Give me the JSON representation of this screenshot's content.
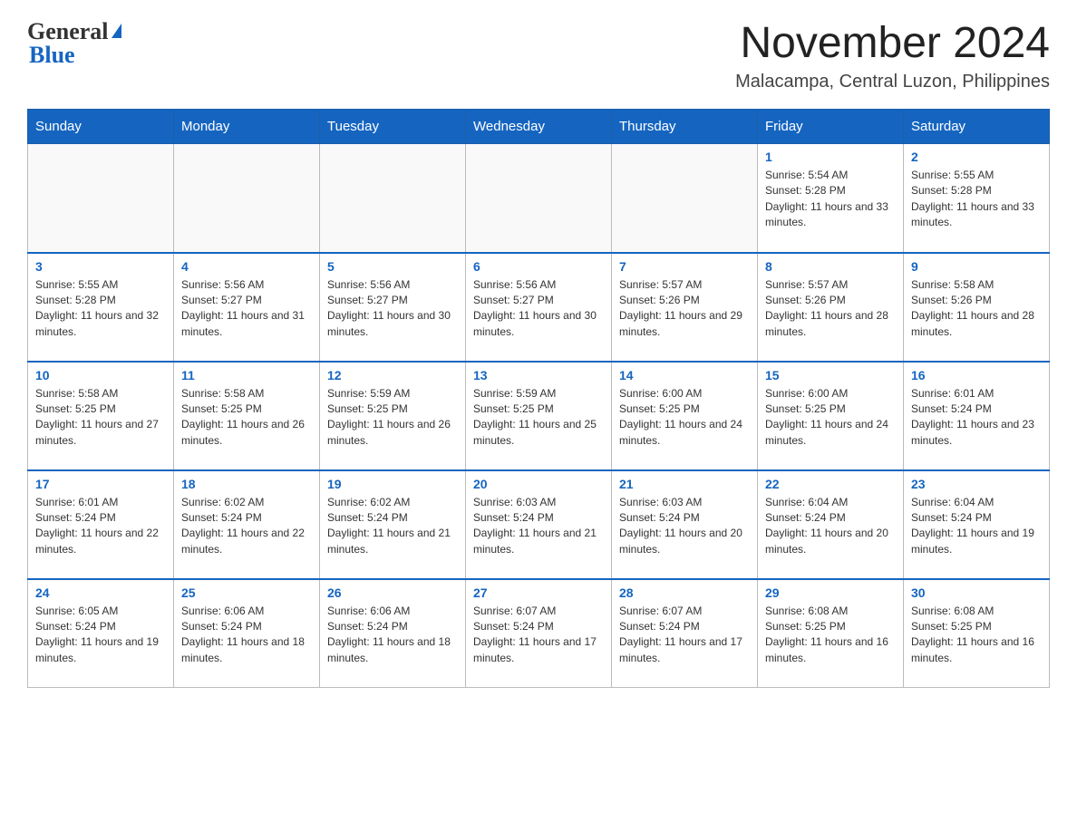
{
  "header": {
    "logo_line1": "General",
    "logo_line2": "Blue",
    "main_title": "November 2024",
    "subtitle": "Malacampa, Central Luzon, Philippines"
  },
  "days_of_week": [
    "Sunday",
    "Monday",
    "Tuesday",
    "Wednesday",
    "Thursday",
    "Friday",
    "Saturday"
  ],
  "weeks": [
    [
      {
        "day": "",
        "info": ""
      },
      {
        "day": "",
        "info": ""
      },
      {
        "day": "",
        "info": ""
      },
      {
        "day": "",
        "info": ""
      },
      {
        "day": "",
        "info": ""
      },
      {
        "day": "1",
        "info": "Sunrise: 5:54 AM\nSunset: 5:28 PM\nDaylight: 11 hours and 33 minutes."
      },
      {
        "day": "2",
        "info": "Sunrise: 5:55 AM\nSunset: 5:28 PM\nDaylight: 11 hours and 33 minutes."
      }
    ],
    [
      {
        "day": "3",
        "info": "Sunrise: 5:55 AM\nSunset: 5:28 PM\nDaylight: 11 hours and 32 minutes."
      },
      {
        "day": "4",
        "info": "Sunrise: 5:56 AM\nSunset: 5:27 PM\nDaylight: 11 hours and 31 minutes."
      },
      {
        "day": "5",
        "info": "Sunrise: 5:56 AM\nSunset: 5:27 PM\nDaylight: 11 hours and 30 minutes."
      },
      {
        "day": "6",
        "info": "Sunrise: 5:56 AM\nSunset: 5:27 PM\nDaylight: 11 hours and 30 minutes."
      },
      {
        "day": "7",
        "info": "Sunrise: 5:57 AM\nSunset: 5:26 PM\nDaylight: 11 hours and 29 minutes."
      },
      {
        "day": "8",
        "info": "Sunrise: 5:57 AM\nSunset: 5:26 PM\nDaylight: 11 hours and 28 minutes."
      },
      {
        "day": "9",
        "info": "Sunrise: 5:58 AM\nSunset: 5:26 PM\nDaylight: 11 hours and 28 minutes."
      }
    ],
    [
      {
        "day": "10",
        "info": "Sunrise: 5:58 AM\nSunset: 5:25 PM\nDaylight: 11 hours and 27 minutes."
      },
      {
        "day": "11",
        "info": "Sunrise: 5:58 AM\nSunset: 5:25 PM\nDaylight: 11 hours and 26 minutes."
      },
      {
        "day": "12",
        "info": "Sunrise: 5:59 AM\nSunset: 5:25 PM\nDaylight: 11 hours and 26 minutes."
      },
      {
        "day": "13",
        "info": "Sunrise: 5:59 AM\nSunset: 5:25 PM\nDaylight: 11 hours and 25 minutes."
      },
      {
        "day": "14",
        "info": "Sunrise: 6:00 AM\nSunset: 5:25 PM\nDaylight: 11 hours and 24 minutes."
      },
      {
        "day": "15",
        "info": "Sunrise: 6:00 AM\nSunset: 5:25 PM\nDaylight: 11 hours and 24 minutes."
      },
      {
        "day": "16",
        "info": "Sunrise: 6:01 AM\nSunset: 5:24 PM\nDaylight: 11 hours and 23 minutes."
      }
    ],
    [
      {
        "day": "17",
        "info": "Sunrise: 6:01 AM\nSunset: 5:24 PM\nDaylight: 11 hours and 22 minutes."
      },
      {
        "day": "18",
        "info": "Sunrise: 6:02 AM\nSunset: 5:24 PM\nDaylight: 11 hours and 22 minutes."
      },
      {
        "day": "19",
        "info": "Sunrise: 6:02 AM\nSunset: 5:24 PM\nDaylight: 11 hours and 21 minutes."
      },
      {
        "day": "20",
        "info": "Sunrise: 6:03 AM\nSunset: 5:24 PM\nDaylight: 11 hours and 21 minutes."
      },
      {
        "day": "21",
        "info": "Sunrise: 6:03 AM\nSunset: 5:24 PM\nDaylight: 11 hours and 20 minutes."
      },
      {
        "day": "22",
        "info": "Sunrise: 6:04 AM\nSunset: 5:24 PM\nDaylight: 11 hours and 20 minutes."
      },
      {
        "day": "23",
        "info": "Sunrise: 6:04 AM\nSunset: 5:24 PM\nDaylight: 11 hours and 19 minutes."
      }
    ],
    [
      {
        "day": "24",
        "info": "Sunrise: 6:05 AM\nSunset: 5:24 PM\nDaylight: 11 hours and 19 minutes."
      },
      {
        "day": "25",
        "info": "Sunrise: 6:06 AM\nSunset: 5:24 PM\nDaylight: 11 hours and 18 minutes."
      },
      {
        "day": "26",
        "info": "Sunrise: 6:06 AM\nSunset: 5:24 PM\nDaylight: 11 hours and 18 minutes."
      },
      {
        "day": "27",
        "info": "Sunrise: 6:07 AM\nSunset: 5:24 PM\nDaylight: 11 hours and 17 minutes."
      },
      {
        "day": "28",
        "info": "Sunrise: 6:07 AM\nSunset: 5:24 PM\nDaylight: 11 hours and 17 minutes."
      },
      {
        "day": "29",
        "info": "Sunrise: 6:08 AM\nSunset: 5:25 PM\nDaylight: 11 hours and 16 minutes."
      },
      {
        "day": "30",
        "info": "Sunrise: 6:08 AM\nSunset: 5:25 PM\nDaylight: 11 hours and 16 minutes."
      }
    ]
  ]
}
